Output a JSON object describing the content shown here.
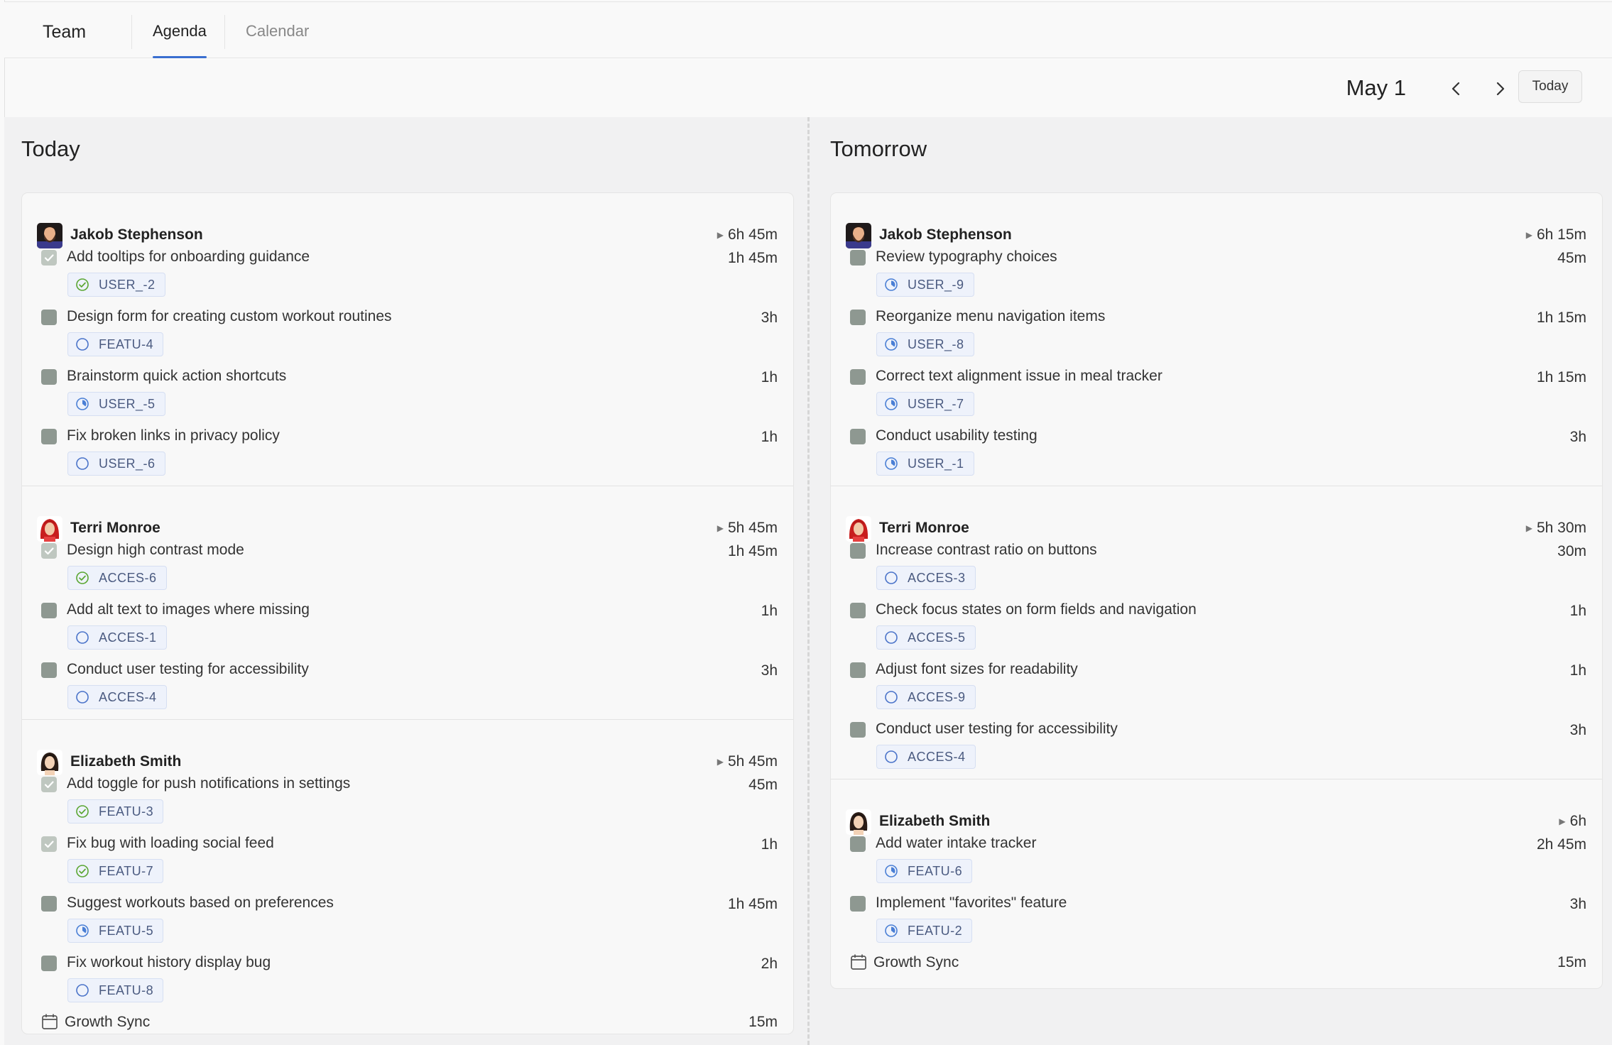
{
  "header": {
    "team_label": "Team",
    "tabs": [
      {
        "label": "Agenda",
        "active": true
      },
      {
        "label": "Calendar",
        "active": false
      }
    ]
  },
  "datebar": {
    "date": "May 1",
    "today_button": "Today"
  },
  "columns": [
    {
      "title": "Today",
      "people": [
        {
          "name": "Jakob Stephenson",
          "avatar": "man-beard-avatar",
          "total": "6h 45m",
          "tasks": [
            {
              "title": "Add tooltips for onboarding guidance",
              "duration": "1h 45m",
              "done": true,
              "tag": "USER_-2",
              "status": "done-circle-icon"
            },
            {
              "title": "Design form for creating custom workout routines",
              "duration": "3h",
              "done": false,
              "tag": "FEATU-4",
              "status": "todo-circle-icon"
            },
            {
              "title": "Brainstorm quick action shortcuts",
              "duration": "1h",
              "done": false,
              "tag": "USER_-5",
              "status": "in-progress-icon"
            },
            {
              "title": "Fix broken links in privacy policy",
              "duration": "1h",
              "done": false,
              "tag": "USER_-6",
              "status": "todo-circle-icon"
            }
          ]
        },
        {
          "name": "Terri Monroe",
          "avatar": "woman-red-hair-avatar",
          "total": "5h 45m",
          "tasks": [
            {
              "title": "Design high contrast mode",
              "duration": "1h 45m",
              "done": true,
              "tag": "ACCES-6",
              "status": "done-circle-icon"
            },
            {
              "title": "Add alt text to images where missing",
              "duration": "1h",
              "done": false,
              "tag": "ACCES-1",
              "status": "todo-circle-icon"
            },
            {
              "title": "Conduct user testing for accessibility",
              "duration": "3h",
              "done": false,
              "tag": "ACCES-4",
              "status": "todo-circle-icon"
            }
          ]
        },
        {
          "name": "Elizabeth Smith",
          "avatar": "woman-dark-hair-avatar",
          "total": "5h 45m",
          "tasks": [
            {
              "title": "Add toggle for push notifications in settings",
              "duration": "45m",
              "done": true,
              "tag": "FEATU-3",
              "status": "done-circle-icon"
            },
            {
              "title": "Fix bug with loading social feed",
              "duration": "1h",
              "done": true,
              "tag": "FEATU-7",
              "status": "done-circle-icon"
            },
            {
              "title": "Suggest workouts based on preferences",
              "duration": "1h 45m",
              "done": false,
              "tag": "FEATU-5",
              "status": "in-progress-icon"
            },
            {
              "title": "Fix workout history display bug",
              "duration": "2h",
              "done": false,
              "tag": "FEATU-8",
              "status": "todo-circle-icon"
            }
          ],
          "events": [
            {
              "title": "Growth Sync",
              "duration": "15m"
            }
          ]
        }
      ]
    },
    {
      "title": "Tomorrow",
      "people": [
        {
          "name": "Jakob Stephenson",
          "avatar": "man-beard-avatar",
          "total": "6h 15m",
          "tasks": [
            {
              "title": "Review typography choices",
              "duration": "45m",
              "done": false,
              "tag": "USER_-9",
              "status": "in-progress-icon"
            },
            {
              "title": "Reorganize menu navigation items",
              "duration": "1h 15m",
              "done": false,
              "tag": "USER_-8",
              "status": "in-progress-icon"
            },
            {
              "title": "Correct text alignment issue in meal tracker",
              "duration": "1h 15m",
              "done": false,
              "tag": "USER_-7",
              "status": "in-progress-icon"
            },
            {
              "title": "Conduct usability testing",
              "duration": "3h",
              "done": false,
              "tag": "USER_-1",
              "status": "in-progress-icon"
            }
          ]
        },
        {
          "name": "Terri Monroe",
          "avatar": "woman-red-hair-avatar",
          "total": "5h 30m",
          "tasks": [
            {
              "title": "Increase contrast ratio on buttons",
              "duration": "30m",
              "done": false,
              "tag": "ACCES-3",
              "status": "todo-circle-icon"
            },
            {
              "title": "Check focus states on form fields and navigation",
              "duration": "1h",
              "done": false,
              "tag": "ACCES-5",
              "status": "todo-circle-icon"
            },
            {
              "title": "Adjust font sizes for readability",
              "duration": "1h",
              "done": false,
              "tag": "ACCES-9",
              "status": "todo-circle-icon"
            },
            {
              "title": "Conduct user testing for accessibility",
              "duration": "3h",
              "done": false,
              "tag": "ACCES-4",
              "status": "todo-circle-icon"
            }
          ]
        },
        {
          "name": "Elizabeth Smith",
          "avatar": "woman-dark-hair-avatar",
          "total": "6h",
          "tasks": [
            {
              "title": "Add water intake tracker",
              "duration": "2h 45m",
              "done": false,
              "tag": "FEATU-6",
              "status": "in-progress-icon"
            },
            {
              "title": "Implement \"favorites\" feature",
              "duration": "3h",
              "done": false,
              "tag": "FEATU-2",
              "status": "in-progress-icon"
            }
          ],
          "events": [
            {
              "title": "Growth Sync",
              "duration": "15m"
            }
          ]
        }
      ]
    }
  ],
  "colors": {
    "accent": "#3a6fd0",
    "done_green": "#5aa632",
    "progress_blue": "#3a7bd5",
    "todo_blue": "#3a6fd0"
  }
}
